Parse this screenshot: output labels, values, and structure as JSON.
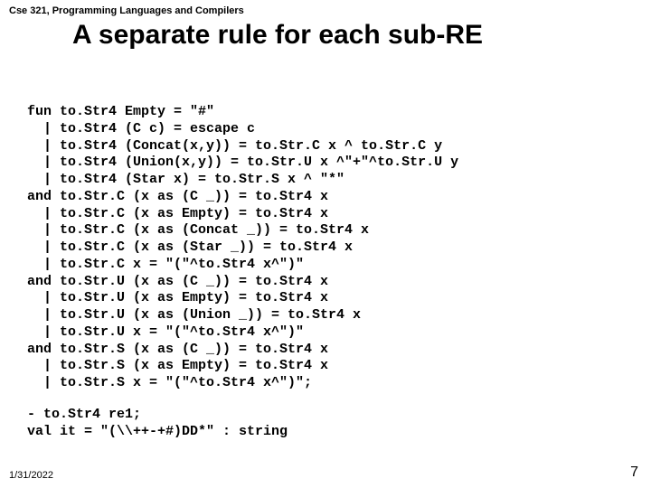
{
  "course": "Cse 321, Programming Languages and Compilers",
  "title": "A separate rule for each sub-RE",
  "codeLines": [
    "fun to.Str4 Empty = \"#\"",
    "  | to.Str4 (C c) = escape c",
    "  | to.Str4 (Concat(x,y)) = to.Str.C x ^ to.Str.C y",
    "  | to.Str4 (Union(x,y)) = to.Str.U x ^\"+\"^to.Str.U y",
    "  | to.Str4 (Star x) = to.Str.S x ^ \"*\"",
    "and to.Str.C (x as (C _)) = to.Str4 x",
    "  | to.Str.C (x as Empty) = to.Str4 x",
    "  | to.Str.C (x as (Concat _)) = to.Str4 x",
    "  | to.Str.C (x as (Star _)) = to.Str4 x",
    "  | to.Str.C x = \"(\"^to.Str4 x^\")\"",
    "and to.Str.U (x as (C _)) = to.Str4 x",
    "  | to.Str.U (x as Empty) = to.Str4 x",
    "  | to.Str.U (x as (Union _)) = to.Str4 x",
    "  | to.Str.U x = \"(\"^to.Str4 x^\")\"",
    "and to.Str.S (x as (C _)) = to.Str4 x",
    "  | to.Str.S (x as Empty) = to.Str4 x",
    "  | to.Str.S x = \"(\"^to.Str4 x^\")\";"
  ],
  "footerLines": [
    "- to.Str4 re1;",
    "val it = \"(\\\\++-+#)DD*\" : string"
  ],
  "date": "1/31/2022",
  "page": "7"
}
